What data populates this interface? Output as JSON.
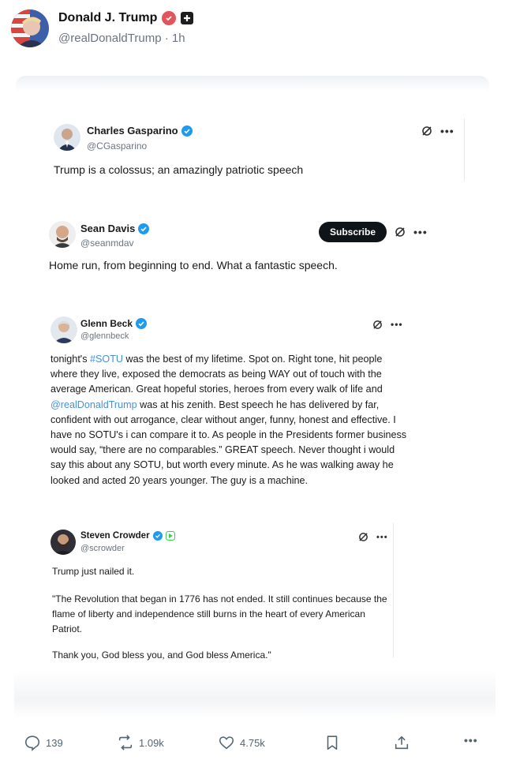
{
  "post": {
    "author_name": "Donald J. Trump",
    "author_handle": "@realDonaldTrump",
    "time": "1h"
  },
  "embeds": [
    {
      "name": "Charles Gasparino",
      "handle": "@CGasparino",
      "text": "Trump is a colossus; an amazingly patriotic speech"
    },
    {
      "name": "Sean Davis",
      "handle": "@seanmdav",
      "subscribe_label": "Subscribe",
      "text": "Home run, from beginning to end. What a fantastic speech."
    },
    {
      "name": "Glenn Beck",
      "handle": "@glennbeck",
      "text_parts": [
        "tonight's ",
        "#SOTU",
        " was the best of my lifetime.  Spot on.  Right tone, hit people where they live, exposed the democrats as being WAY out of touch with the average American.  Great hopeful stories, heroes from every walk of life and ",
        "@realDonaldTrump",
        " was at his zenith.  Best speech he has delivered by far, confident with out arrogance, clear without anger, funny, honest and effective.  I have no SOTU's i can compare it to.  As people in the Presidents former business would say, “there are no comparables.”  GREAT speech. Never thought i would say this about any SOTU, but worth every minute.  As he was walking away he looked and acted 20 years younger. The guy is a machine."
      ]
    },
    {
      "name": "Steven Crowder",
      "handle": "@scrowder",
      "line1": "Trump just nailed it.",
      "line2": "\"The Revolution that began in 1776 has not ended. It still continues because the flame of liberty and independence still burns in the heart of every American Patriot.",
      "line3": "Thank you, God bless you, and God bless America.\""
    }
  ],
  "actions": {
    "replies": "139",
    "reposts": "1.09k",
    "likes": "4.75k"
  },
  "more_glyph": "•••",
  "colors": {
    "verified": "#1d9bf0",
    "link": "#4a90d9",
    "badge_red": "#e0565b",
    "icon_gray": "#536471"
  }
}
